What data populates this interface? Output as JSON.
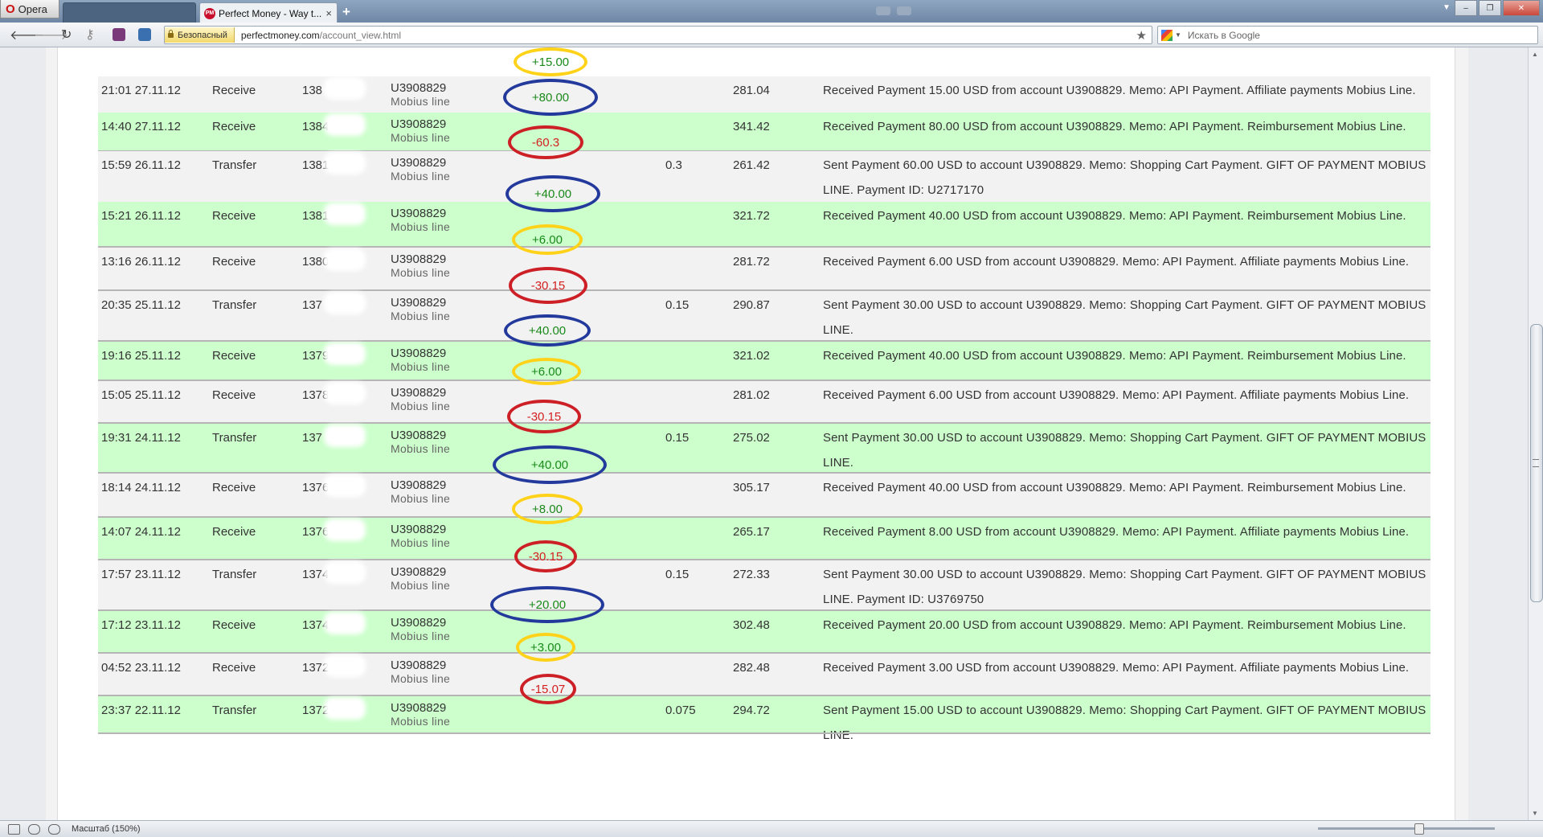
{
  "browser": {
    "menu_label": "Opera",
    "tab_title": "Perfect Money - Way t...",
    "tab_favicon": "PM",
    "tab_close": "×",
    "new_tab": "+",
    "secure_label": "Безопасный",
    "url_host": "perfectmoney.com",
    "url_path": "/account_view.html",
    "search_placeholder": "Искать в Google",
    "zoom_label": "Масштаб (150%)"
  },
  "rows": [
    {
      "date": "21:01 27.11.12",
      "type": "Receive",
      "batch": "138",
      "acct": "U3908829",
      "acct_sub": "Mobius line",
      "amount": "+15.00",
      "ring": "yellow",
      "fee": "",
      "balance": "281.04",
      "memo": "Received Payment 15.00 USD from account U3908829. Memo: API Payment. Affiliate payments Mobius Line.",
      "bg": "grey"
    },
    {
      "date": "14:40 27.11.12",
      "type": "Receive",
      "batch": "1384",
      "acct": "U3908829",
      "acct_sub": "Mobius line",
      "amount": "+80.00",
      "ring": "blue",
      "fee": "",
      "balance": "341.42",
      "memo": "Received Payment 80.00 USD from account U3908829. Memo: API Payment. Reimbursement Mobius Line.",
      "bg": "green"
    },
    {
      "date": "15:59 26.11.12",
      "type": "Transfer",
      "batch": "1381",
      "acct": "U3908829",
      "acct_sub": "Mobius line",
      "amount": "-60.3",
      "ring": "red",
      "fee": "0.3",
      "balance": "261.42",
      "memo": "Sent Payment 60.00 USD to account U3908829. Memo: Shopping Cart Payment. GIFT OF PAYMENT MOBIUS LINE. Payment ID: U2717170",
      "bg": "grey"
    },
    {
      "date": "15:21 26.11.12",
      "type": "Receive",
      "batch": "1381",
      "acct": "U3908829",
      "acct_sub": "Mobius line",
      "amount": "+40.00",
      "ring": "blue",
      "fee": "",
      "balance": "321.72",
      "memo": "Received Payment 40.00 USD from account U3908829. Memo: API Payment. Reimbursement Mobius Line.",
      "bg": "green"
    },
    {
      "date": "13:16 26.11.12",
      "type": "Receive",
      "batch": "1380",
      "acct": "U3908829",
      "acct_sub": "Mobius line",
      "amount": "+6.00",
      "ring": "yellow",
      "fee": "",
      "balance": "281.72",
      "memo": "Received Payment 6.00 USD from account U3908829. Memo: API Payment. Affiliate payments Mobius Line.",
      "bg": "grey"
    },
    {
      "date": "20:35 25.11.12",
      "type": "Transfer",
      "batch": "137",
      "acct": "U3908829",
      "acct_sub": "Mobius line",
      "amount": "-30.15",
      "ring": "red",
      "fee": "0.15",
      "balance": "290.87",
      "memo": "Sent Payment 30.00 USD to account U3908829. Memo: Shopping Cart Payment. GIFT OF PAYMENT MOBIUS LINE.",
      "bg": "grey"
    },
    {
      "date": "19:16 25.11.12",
      "type": "Receive",
      "batch": "13790",
      "acct": "U3908829",
      "acct_sub": "Mobius line",
      "amount": "+40.00",
      "ring": "blue",
      "fee": "",
      "balance": "321.02",
      "memo": "Received Payment 40.00 USD from account U3908829. Memo: API Payment. Reimbursement Mobius Line.",
      "bg": "green"
    },
    {
      "date": "15:05 25.11.12",
      "type": "Receive",
      "batch": "1378",
      "acct": "U3908829",
      "acct_sub": "Mobius line",
      "amount": "+6.00",
      "ring": "yellow",
      "fee": "",
      "balance": "281.02",
      "memo": "Received Payment 6.00 USD from account U3908829. Memo: API Payment. Affiliate payments Mobius Line.",
      "bg": "grey"
    },
    {
      "date": "19:31 24.11.12",
      "type": "Transfer",
      "batch": "137",
      "acct": "U3908829",
      "acct_sub": "Mobius line",
      "amount": "-30.15",
      "ring": "red",
      "fee": "0.15",
      "balance": "275.02",
      "memo": "Sent Payment 30.00 USD to account U3908829. Memo: Shopping Cart Payment. GIFT OF PAYMENT MOBIUS LINE.",
      "bg": "green"
    },
    {
      "date": "18:14 24.11.12",
      "type": "Receive",
      "batch": "1376",
      "acct": "U3908829",
      "acct_sub": "Mobius line",
      "amount": "+40.00",
      "ring": "blue",
      "fee": "",
      "balance": "305.17",
      "memo": "Received Payment 40.00 USD from account U3908829. Memo: API Payment. Reimbursement Mobius Line.",
      "bg": "grey"
    },
    {
      "date": "14:07 24.11.12",
      "type": "Receive",
      "batch": "1376",
      "acct": "U3908829",
      "acct_sub": "Mobius line",
      "amount": "+8.00",
      "ring": "yellow",
      "fee": "",
      "balance": "265.17",
      "memo": "Received Payment 8.00 USD from account U3908829. Memo: API Payment. Affiliate payments Mobius Line.",
      "bg": "green"
    },
    {
      "date": "17:57 23.11.12",
      "type": "Transfer",
      "batch": "1374",
      "acct": "U3908829",
      "acct_sub": "Mobius line",
      "amount": "-30.15",
      "ring": "red",
      "fee": "0.15",
      "balance": "272.33",
      "memo": "Sent Payment 30.00 USD to account U3908829. Memo: Shopping Cart Payment. GIFT OF PAYMENT MOBIUS LINE. Payment ID: U3769750",
      "bg": "grey"
    },
    {
      "date": "17:12 23.11.12",
      "type": "Receive",
      "batch": "1374",
      "acct": "U3908829",
      "acct_sub": "Mobius line",
      "amount": "+20.00",
      "ring": "blue",
      "fee": "",
      "balance": "302.48",
      "memo": "Received Payment 20.00 USD from account U3908829. Memo: API Payment. Reimbursement Mobius Line.",
      "bg": "green"
    },
    {
      "date": "04:52 23.11.12",
      "type": "Receive",
      "batch": "1372",
      "acct": "U3908829",
      "acct_sub": "Mobius line",
      "amount": "+3.00",
      "ring": "yellow",
      "fee": "",
      "balance": "282.48",
      "memo": "Received Payment 3.00 USD from account U3908829. Memo: API Payment. Affiliate payments Mobius Line.",
      "bg": "grey"
    },
    {
      "date": "23:37 22.11.12",
      "type": "Transfer",
      "batch": "1372",
      "acct": "U3908829",
      "acct_sub": "Mobius line",
      "amount": "-15.07",
      "ring": "red",
      "fee": "0.075",
      "balance": "294.72",
      "memo": "Sent Payment 15.00 USD to account U3908829. Memo: Shopping Cart Payment. GIFT OF PAYMENT MOBIUS LINE.",
      "bg": "green"
    }
  ],
  "colors": {
    "row_green": "#ccffcc",
    "row_grey": "#f2f2f2",
    "ring_yellow": "#ffd21a",
    "ring_blue": "#233a9c",
    "ring_red": "#cc1f26",
    "positive": "#1a8a1a",
    "negative": "#d42020"
  }
}
